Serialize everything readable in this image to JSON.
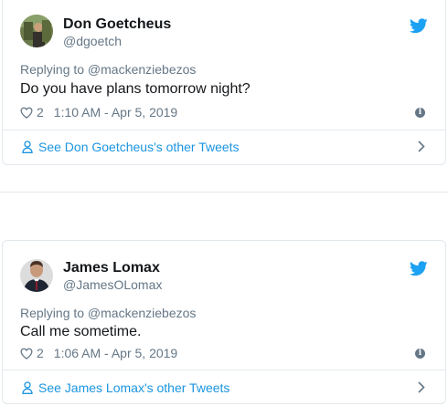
{
  "tweets": [
    {
      "name": "Don Goetcheus",
      "handle": "@dgoetch",
      "replying_to": "Replying to @mackenziebezos",
      "text": "Do you have plans tomorrow night?",
      "likes": "2",
      "timestamp": "1:10 AM - Apr 5, 2019",
      "more_link": "See Don Goetcheus's other Tweets"
    },
    {
      "name": "James Lomax",
      "handle": "@JamesOLomax",
      "replying_to": "Replying to @mackenziebezos",
      "text": "Call me sometime.",
      "likes": "2",
      "timestamp": "1:06 AM - Apr 5, 2019",
      "more_link": "See James Lomax's other Tweets"
    }
  ],
  "icons": {
    "bird": "twitter-bird-icon",
    "heart": "heart-icon",
    "info": "info-icon",
    "person": "person-icon",
    "chevron": "chevron-right-icon",
    "info_glyph": "i"
  },
  "colors": {
    "accent": "#1da1f2",
    "link": "#1b95e0",
    "muted": "#657786",
    "text": "#14171a"
  }
}
